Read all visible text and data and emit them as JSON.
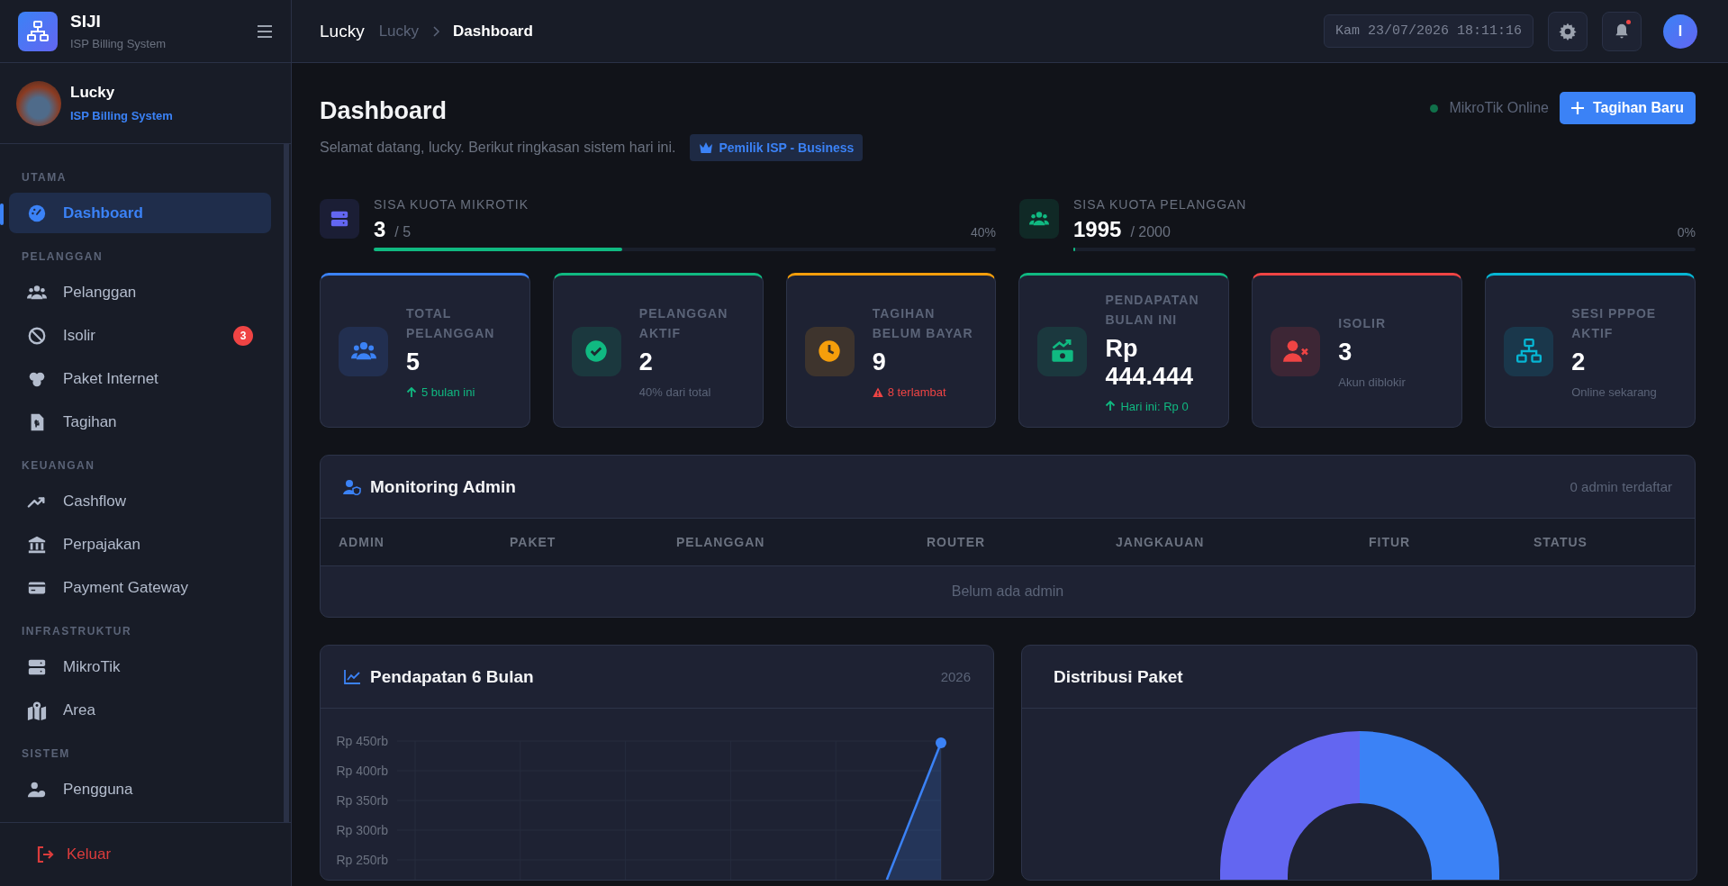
{
  "brand": {
    "name": "SIJI",
    "subtitle": "ISP Billing System"
  },
  "profile": {
    "name": "Lucky",
    "role": "ISP Billing System"
  },
  "sidebar": {
    "sections": [
      {
        "label": "UTAMA",
        "items": [
          {
            "label": "Dashboard",
            "selected": true
          }
        ]
      },
      {
        "label": "PELANGGAN",
        "items": [
          {
            "label": "Pelanggan",
            "selected": false
          },
          {
            "label": "Isolir",
            "selected": false,
            "badge": "3"
          },
          {
            "label": "Paket Internet",
            "selected": false
          },
          {
            "label": "Tagihan",
            "selected": false
          }
        ]
      },
      {
        "label": "KEUANGAN",
        "items": [
          {
            "label": "Cashflow",
            "selected": false
          },
          {
            "label": "Perpajakan",
            "selected": false
          },
          {
            "label": "Payment Gateway",
            "selected": false
          }
        ]
      },
      {
        "label": "INFRASTRUKTUR",
        "items": [
          {
            "label": "MikroTik",
            "selected": false
          },
          {
            "label": "Area",
            "selected": false
          }
        ]
      },
      {
        "label": "SISTEM",
        "items": [
          {
            "label": "Pengguna",
            "selected": false
          }
        ]
      }
    ],
    "logout": "Keluar"
  },
  "header": {
    "breadcrumb": [
      "Lucky",
      "Lucky",
      "Dashboard"
    ],
    "datetime": "Kam 23/07/2026 18:11:16",
    "has_notification": true,
    "avatar_initial": "I"
  },
  "page": {
    "title": "Dashboard",
    "subtitle": "Selamat datang, lucky. Berikut ringkasan sistem hari ini.",
    "badge": "Pemilik ISP - Business",
    "status": {
      "label": "MikroTik Online",
      "online": true
    },
    "button": "Tagihan Baru"
  },
  "quotas": [
    {
      "label": "SISA KUOTA MIKROTIK",
      "value": "3",
      "total": "/ 5",
      "percent": "40%",
      "level": 0.4,
      "color": "#6366f1"
    },
    {
      "label": "SISA KUOTA PELANGGAN",
      "value": "1995",
      "total": "/ 2000",
      "percent": "0%",
      "level": 0.0025,
      "color": "#10b981"
    }
  ],
  "stats": [
    {
      "label": "TOTAL PELANGGAN",
      "value": "5",
      "note": "5 bulan ini",
      "kind": "up",
      "color": "#3b82f6"
    },
    {
      "label": "PELANGGAN AKTIF",
      "value": "2",
      "note": "40% dari total",
      "kind": "plain",
      "color": "#10b981"
    },
    {
      "label": "TAGIHAN BELUM BAYAR",
      "value": "9",
      "note": "8 terlambat",
      "kind": "warn",
      "color": "#f59e0b"
    },
    {
      "label": "PENDAPATAN BULAN INI",
      "value": "Rp 444.444",
      "note": "Hari ini: Rp 0",
      "kind": "up",
      "color": "#10b981"
    },
    {
      "label": "ISOLIR",
      "value": "3",
      "note": "Akun diblokir",
      "kind": "plain",
      "color": "#ef4444"
    },
    {
      "label": "SESI PPPOE AKTIF",
      "value": "2",
      "note": "Online sekarang",
      "kind": "plain",
      "color": "#06b6d4"
    }
  ],
  "monitoring": {
    "title": "Monitoring Admin",
    "count": "0 admin terdaftar",
    "columns": [
      "ADMIN",
      "PAKET",
      "PELANGGAN",
      "ROUTER",
      "JANGKAUAN",
      "FITUR",
      "STATUS"
    ],
    "empty": "Belum ada admin"
  },
  "revenue": {
    "title": "Pendapatan 6 Bulan",
    "year": "2026",
    "y_axis_labels": [
      "Rp 450rb",
      "Rp 400rb",
      "Rp 350rb",
      "Rp 300rb",
      "Rp 250rb"
    ]
  },
  "distribution": {
    "title": "Distribusi Paket"
  }
}
